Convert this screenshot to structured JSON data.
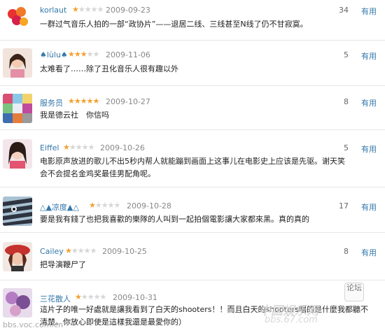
{
  "useful_label": "有用",
  "comments": [
    {
      "user": "korlaut",
      "stars": 1,
      "date": "2009-09-23",
      "count": "34",
      "text": "一群过气音乐人拍的一部“政协片”——退居二线、三线甚至N线了仍不甘寂寞。",
      "avatar_color": "#e7322f"
    },
    {
      "user": "♠lùlu♠",
      "stars": 3,
      "date": "2009-11-06",
      "count": "5",
      "text": "太难看了……除了丑化音乐人很有趣以外",
      "avatar_color": "#e9c7b7"
    },
    {
      "user": "服务员",
      "stars": 5,
      "date": "2009-10-27",
      "count": "8",
      "text": "我是德云社　你信吗",
      "avatar_color": "#7d5ba6"
    },
    {
      "user": "Eiffel",
      "stars": 1,
      "date": "2009-10-26",
      "count": "5",
      "text": "电影原声放进的歌儿不出5秒内帮人就能蹦到画面上这事儿在电影史上应该是先驱。谢天笑会不会提名金鸡奖最佳男配角呢。",
      "avatar_color": "#c7637a"
    },
    {
      "user": "△▲凉度▲△",
      "stars": 1,
      "date": "2009-10-28",
      "count": "17",
      "text": "要是我有錢了也把我喜歡的樂隊的人叫到一起拍個電影讓大家都來黑。真的真的",
      "avatar_color": "#6b8fa8"
    },
    {
      "user": "Cailey",
      "stars": 1,
      "date": "2009-10-25",
      "count": "8",
      "text": "把导演鞭尸了",
      "avatar_color": "#b9342f"
    },
    {
      "user": "三花散人",
      "stars": 1,
      "date": "2009-10-31",
      "count": "",
      "text": "這片子的唯一好處就是讓我看到了白天的shooters！！而且白天的shooters唱的是什麼我都聽不清楚。你放心即使是這樣我還是最愛你的）",
      "avatar_color": "#9a6b9f"
    }
  ],
  "watermark": {
    "site": "bbs.voc.com.cn",
    "right": "中国娱乐网",
    "right2": "bbs.67.com",
    "forum": "论坛"
  }
}
